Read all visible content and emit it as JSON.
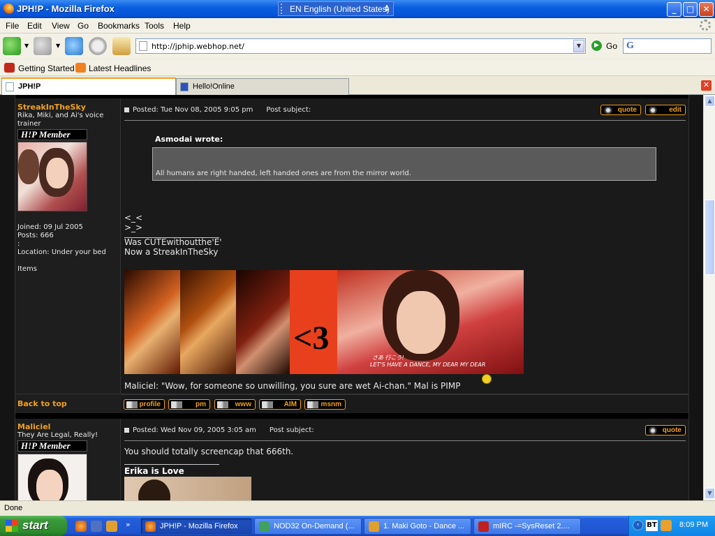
{
  "window": {
    "title": "JPH!P - Mozilla Firefox",
    "language": "EN English (United States)",
    "minimize": "_",
    "maximize": "□",
    "close": "✕"
  },
  "menu": [
    "File",
    "Edit",
    "View",
    "Go",
    "Bookmarks",
    "Tools",
    "Help"
  ],
  "nav": {
    "url": "http://jphip.webhop.net/",
    "go_label": "Go",
    "search_placeholder": ""
  },
  "bookmarks": [
    "Getting Started",
    "Latest Headlines"
  ],
  "tabs": [
    {
      "label": "JPH!P",
      "active": true
    },
    {
      "label": "Hello!Online",
      "active": false
    }
  ],
  "posts": [
    {
      "author": "StreakInTheSky",
      "user_title_1": "Rika, Miki, and Ai's voice",
      "user_title_2": "trainer",
      "rank": "H!P Member",
      "joined": "Joined: 09 Jul 2005",
      "posts": "Posts: 666",
      "colon": ":",
      "location": "Location: Under your bed",
      "items": "Items",
      "header": "Posted: Tue Nov 08, 2005 9:05 pm      Post subject:",
      "quote_btn": "quote",
      "edit_btn": "edit",
      "quote_author": "Asmodai wrote:",
      "quote_text": "All humans are right handed, left handed ones are from the mirror world.",
      "emote_1": "<_<",
      "emote_2": ">_>",
      "sig_1": "Was CUTEwithoutthe'E'",
      "sig_2": "Now a StreakInTheSky",
      "banner_heart": "<3",
      "banner_caption_1": "さあ 行こう!",
      "banner_caption_2": "LET'S HAVE A DANCE, MY DEAR MY DEAR",
      "sig_quote": "Maliciel: \"Wow, for someone so unwilling, you sure are wet Ai-chan.\" Mal is PIMP"
    },
    {
      "author": "Maliciel",
      "user_title_1": "They Are Legal, Really!",
      "rank": "H!P Member",
      "header": "Posted: Wed Nov 09, 2005 3:05 am      Post subject:",
      "quote_btn": "quote",
      "text": "You should totally screencap that 666th.",
      "sig": "Erika is Love"
    }
  ],
  "profile_links": {
    "back": "Back to top",
    "links": [
      "profile",
      "pm",
      "www",
      "AIM",
      "msnm"
    ]
  },
  "status": "Done",
  "taskbar": {
    "start": "start",
    "tasks": [
      "JPH!P - Mozilla Firefox",
      "NOD32 On-Demand (...",
      "1. Maki Goto - Dance ...",
      "mIRC -=SysReset 2...."
    ],
    "clock": "8:09 PM",
    "bt": "BT"
  }
}
